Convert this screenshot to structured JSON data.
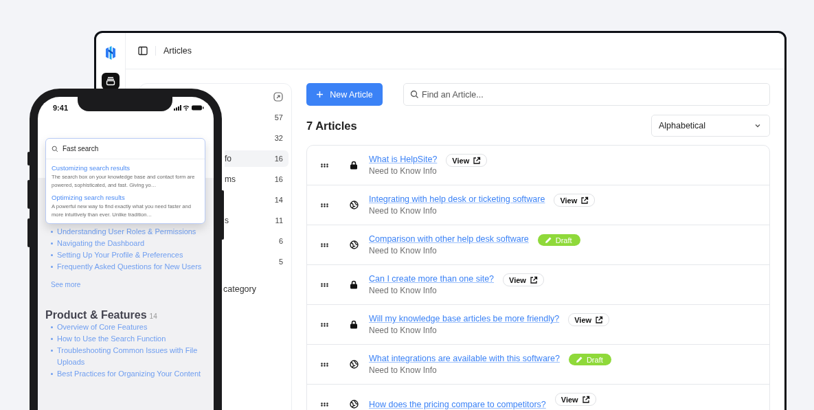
{
  "topbar": {
    "title": "Articles"
  },
  "categories": {
    "items": [
      {
        "count": "57",
        "selected": false
      },
      {
        "count": "32",
        "selected": false
      },
      {
        "name": "fo",
        "count": "16",
        "selected": true
      },
      {
        "name": "ms",
        "count": "16",
        "selected": false
      },
      {
        "count": "14",
        "selected": false
      },
      {
        "name": "s",
        "count": "11",
        "selected": false
      },
      {
        "count": "6",
        "selected": false
      },
      {
        "count": "5",
        "selected": false
      }
    ],
    "add_label": "category"
  },
  "toolbar": {
    "new_button": "New Article",
    "search_placeholder": "Find an Article...",
    "heading": "7 Articles",
    "sort": "Alphabetical"
  },
  "articles": [
    {
      "title": "What is HelpSite?",
      "category": "Need to Know Info",
      "locked": true,
      "draft": false,
      "badge": "View"
    },
    {
      "title": "Integrating with help desk or ticketing software",
      "category": "Need to Know Info",
      "locked": false,
      "draft": false,
      "badge": "View"
    },
    {
      "title": "Comparison with other help desk software",
      "category": "Need to Know Info",
      "locked": false,
      "draft": true,
      "badge": "Draft"
    },
    {
      "title": "Can I create more than one site?",
      "category": "Need to Know Info",
      "locked": true,
      "draft": false,
      "badge": "View"
    },
    {
      "title": "Will my knowledge base articles be more friendly?",
      "category": "Need to Know Info",
      "locked": true,
      "draft": false,
      "badge": "View"
    },
    {
      "title": "What integrations are available with this software?",
      "category": "Need to Know Info",
      "locked": false,
      "draft": true,
      "badge": "Draft"
    },
    {
      "title": "How does the pricing compare to competitors?",
      "locked": false,
      "draft": false,
      "badge": "View"
    }
  ],
  "phone": {
    "time": "9:41",
    "search_value": "Fast search",
    "results": [
      {
        "title": "Customizing search results",
        "snippet": "The search box on your knowledge base and contact form are powered, sophisticated, and fast. Giving yo…"
      },
      {
        "title": "Optimizing search results",
        "snippet": "A powerful new way to find exactly what you need faster and more intuitively than ever. Unlike tradition…"
      }
    ],
    "list": [
      "Understanding User Roles & Permissions",
      "Navigating the Dashboard",
      "Setting Up Your Profile & Preferences",
      "Frequently Asked Questions for New Users"
    ],
    "see_more": "See more",
    "section": {
      "title": "Product & Features",
      "count": "14",
      "items": [
        "Overview of Core Features",
        "How to Use the Search Function",
        "Troubleshooting Common Issues with File Uploads",
        "Best Practices for Organizing Your Content"
      ]
    }
  }
}
